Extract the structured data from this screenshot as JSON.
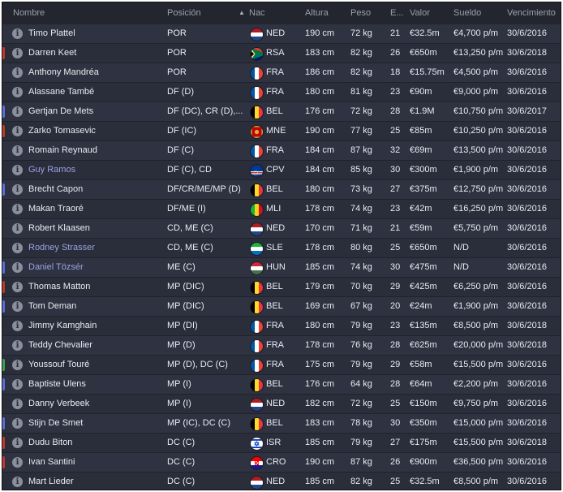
{
  "columns": {
    "name": "Nombre",
    "position": "Posición",
    "nation": "Nac",
    "height": "Altura",
    "weight": "Peso",
    "age": "E...",
    "value": "Valor",
    "wage": "Sueldo",
    "expires": "Vencimiento"
  },
  "colors": {
    "loan_name": "#9aa4e0",
    "edge_red": "#c0392b",
    "edge_blue": "#5b6fd6",
    "edge_green": "#3fa34d"
  },
  "players": [
    {
      "name": "Timo Plattel",
      "position": "POR",
      "nation": "NED",
      "flag": "NED",
      "height": "190 cm",
      "weight": "72 kg",
      "age": "21",
      "value": "€32.5m",
      "wage": "€4,700 p/m",
      "expires": "30/6/2016",
      "edge": "none",
      "loan": false
    },
    {
      "name": "Darren Keet",
      "position": "POR",
      "nation": "RSA",
      "flag": "RSA",
      "height": "183 cm",
      "weight": "82 kg",
      "age": "26",
      "value": "€650m",
      "wage": "€13,250 p/m",
      "expires": "30/6/2018",
      "edge": "red",
      "loan": false
    },
    {
      "name": "Anthony Mandréa",
      "position": "POR",
      "nation": "FRA",
      "flag": "FRA",
      "height": "186 cm",
      "weight": "82 kg",
      "age": "18",
      "value": "€15.75m",
      "wage": "€4,500 p/m",
      "expires": "30/6/2016",
      "edge": "none",
      "loan": false
    },
    {
      "name": "Alassane També",
      "position": "DF (D)",
      "nation": "FRA",
      "flag": "FRA",
      "height": "180 cm",
      "weight": "81 kg",
      "age": "23",
      "value": "€90m",
      "wage": "€9,000 p/m",
      "expires": "30/6/2016",
      "edge": "none",
      "loan": false
    },
    {
      "name": "Gertjan De Mets",
      "position": "DF (DC), CR (D),...",
      "nation": "BEL",
      "flag": "BEL",
      "height": "176 cm",
      "weight": "72 kg",
      "age": "28",
      "value": "€1.9M",
      "wage": "€10,750 p/m",
      "expires": "30/6/2017",
      "edge": "blue",
      "loan": false
    },
    {
      "name": "Zarko Tomasevic",
      "position": "DF (IC)",
      "nation": "MNE",
      "flag": "MNE",
      "height": "190 cm",
      "weight": "77 kg",
      "age": "25",
      "value": "€85m",
      "wage": "€10,250 p/m",
      "expires": "30/6/2016",
      "edge": "red",
      "loan": false
    },
    {
      "name": "Romain Reynaud",
      "position": "DF (C)",
      "nation": "FRA",
      "flag": "FRA",
      "height": "184 cm",
      "weight": "87 kg",
      "age": "32",
      "value": "€69m",
      "wage": "€13,500 p/m",
      "expires": "30/6/2016",
      "edge": "none",
      "loan": false
    },
    {
      "name": "Guy Ramos",
      "position": "DF (C), CD",
      "nation": "CPV",
      "flag": "CPV",
      "height": "184 cm",
      "weight": "85 kg",
      "age": "30",
      "value": "€300m",
      "wage": "€1,900 p/m",
      "expires": "30/6/2016",
      "edge": "none",
      "loan": true
    },
    {
      "name": "Brecht Capon",
      "position": "DF/CR/ME/MP (D)",
      "nation": "BEL",
      "flag": "BEL",
      "height": "180 cm",
      "weight": "73 kg",
      "age": "27",
      "value": "€375m",
      "wage": "€12,750 p/m",
      "expires": "30/6/2016",
      "edge": "blue",
      "loan": false
    },
    {
      "name": "Makan Traoré",
      "position": "DF/ME (I)",
      "nation": "MLI",
      "flag": "MLI",
      "height": "178 cm",
      "weight": "74 kg",
      "age": "23",
      "value": "€42m",
      "wage": "€16,250 p/m",
      "expires": "30/6/2016",
      "edge": "none",
      "loan": false
    },
    {
      "name": "Robert Klaasen",
      "position": "CD, ME (C)",
      "nation": "NED",
      "flag": "NED",
      "height": "170 cm",
      "weight": "71 kg",
      "age": "21",
      "value": "€59m",
      "wage": "€5,750 p/m",
      "expires": "30/6/2016",
      "edge": "none",
      "loan": false
    },
    {
      "name": "Rodney Strasser",
      "position": "CD, ME (C)",
      "nation": "SLE",
      "flag": "SLE",
      "height": "178 cm",
      "weight": "80 kg",
      "age": "25",
      "value": "€650m",
      "wage": "N/D",
      "expires": "30/6/2016",
      "edge": "none",
      "loan": true
    },
    {
      "name": "Daniel Tözsér",
      "position": "ME (C)",
      "nation": "HUN",
      "flag": "HUN",
      "height": "185 cm",
      "weight": "74 kg",
      "age": "30",
      "value": "€475m",
      "wage": "N/D",
      "expires": "30/6/2016",
      "edge": "blue",
      "loan": true
    },
    {
      "name": "Thomas Matton",
      "position": "MP (DIC)",
      "nation": "BEL",
      "flag": "BEL",
      "height": "179 cm",
      "weight": "70 kg",
      "age": "29",
      "value": "€425m",
      "wage": "€6,250 p/m",
      "expires": "30/6/2016",
      "edge": "red",
      "loan": false
    },
    {
      "name": "Tom Deman",
      "position": "MP (DIC)",
      "nation": "BEL",
      "flag": "BEL",
      "height": "169 cm",
      "weight": "67 kg",
      "age": "20",
      "value": "€24m",
      "wage": "€1,900 p/m",
      "expires": "30/6/2016",
      "edge": "blue",
      "loan": false
    },
    {
      "name": "Jimmy Kamghain",
      "position": "MP (DI)",
      "nation": "FRA",
      "flag": "FRA",
      "height": "180 cm",
      "weight": "79 kg",
      "age": "23",
      "value": "€135m",
      "wage": "€8,500 p/m",
      "expires": "30/6/2018",
      "edge": "none",
      "loan": false
    },
    {
      "name": "Teddy Chevalier",
      "position": "MP (D)",
      "nation": "FRA",
      "flag": "FRA",
      "height": "178 cm",
      "weight": "76 kg",
      "age": "28",
      "value": "€625m",
      "wage": "€20,000 p/m",
      "expires": "30/6/2018",
      "edge": "none",
      "loan": false
    },
    {
      "name": "Youssouf Touré",
      "position": "MP (D), DC (C)",
      "nation": "FRA",
      "flag": "FRA",
      "height": "175 cm",
      "weight": "79 kg",
      "age": "29",
      "value": "€58m",
      "wage": "€15,500 p/m",
      "expires": "30/6/2016",
      "edge": "green",
      "loan": false
    },
    {
      "name": "Baptiste Ulens",
      "position": "MP (I)",
      "nation": "BEL",
      "flag": "BEL",
      "height": "176 cm",
      "weight": "64 kg",
      "age": "28",
      "value": "€64m",
      "wage": "€2,200 p/m",
      "expires": "30/6/2016",
      "edge": "blue",
      "loan": false
    },
    {
      "name": "Danny Verbeek",
      "position": "MP (I)",
      "nation": "NED",
      "flag": "NED",
      "height": "182 cm",
      "weight": "72 kg",
      "age": "25",
      "value": "€150m",
      "wage": "€9,750 p/m",
      "expires": "30/6/2016",
      "edge": "none",
      "loan": false
    },
    {
      "name": "Stijn De Smet",
      "position": "MP (IC), DC (C)",
      "nation": "BEL",
      "flag": "BEL",
      "height": "183 cm",
      "weight": "78 kg",
      "age": "30",
      "value": "€350m",
      "wage": "€15,000 p/m",
      "expires": "30/6/2016",
      "edge": "blue",
      "loan": false
    },
    {
      "name": "Dudu Biton",
      "position": "DC (C)",
      "nation": "ISR",
      "flag": "ISR",
      "height": "185 cm",
      "weight": "79 kg",
      "age": "27",
      "value": "€175m",
      "wage": "€15,500 p/m",
      "expires": "30/6/2018",
      "edge": "red",
      "loan": false
    },
    {
      "name": "Ivan Santini",
      "position": "DC (C)",
      "nation": "CRO",
      "flag": "CRO",
      "height": "190 cm",
      "weight": "87 kg",
      "age": "26",
      "value": "€900m",
      "wage": "€36,500 p/m",
      "expires": "30/6/2016",
      "edge": "red",
      "loan": false
    },
    {
      "name": "Mart Lieder",
      "position": "DC (C)",
      "nation": "NED",
      "flag": "NED",
      "height": "185 cm",
      "weight": "82 kg",
      "age": "25",
      "value": "€32.5m",
      "wage": "€8,500 p/m",
      "expires": "30/6/2016",
      "edge": "none",
      "loan": false
    }
  ]
}
